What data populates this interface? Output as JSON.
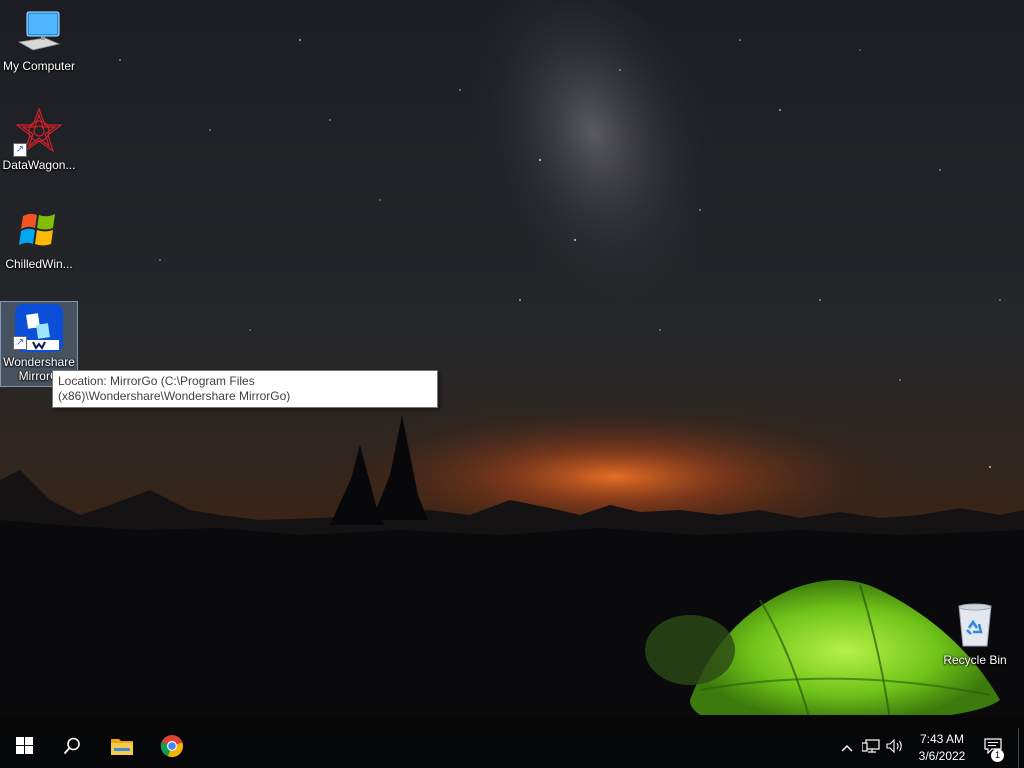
{
  "desktop": {
    "icons": [
      {
        "label": "My Computer"
      },
      {
        "label": "DataWagon..."
      },
      {
        "label": "ChilledWin..."
      },
      {
        "label": "Wondershare MirrorGo"
      },
      {
        "label": "Recycle Bin"
      }
    ],
    "selected_icon_label_line1": "Wondershare",
    "selected_icon_label_line2": "MirrorG"
  },
  "tooltip": {
    "text": "Location: MirrorGo (C:\\Program Files (x86)\\Wondershare\\Wondershare MirrorGo)"
  },
  "taskbar": {
    "start_icon": "windows-logo-icon",
    "search_icon": "search-icon",
    "pinned": [
      {
        "icon": "file-explorer-icon"
      },
      {
        "icon": "chrome-icon"
      }
    ],
    "tray": {
      "icons": [
        "chevron-up-icon",
        "network-icon",
        "volume-icon"
      ],
      "time": "7:43 AM",
      "date": "3/6/2022",
      "notification_count": "1"
    }
  },
  "colors": {
    "taskbar_bg": "#060709",
    "tent_green": "#7ed321",
    "horizon_glow": "#e0641e",
    "tooltip_border": "#767676"
  }
}
